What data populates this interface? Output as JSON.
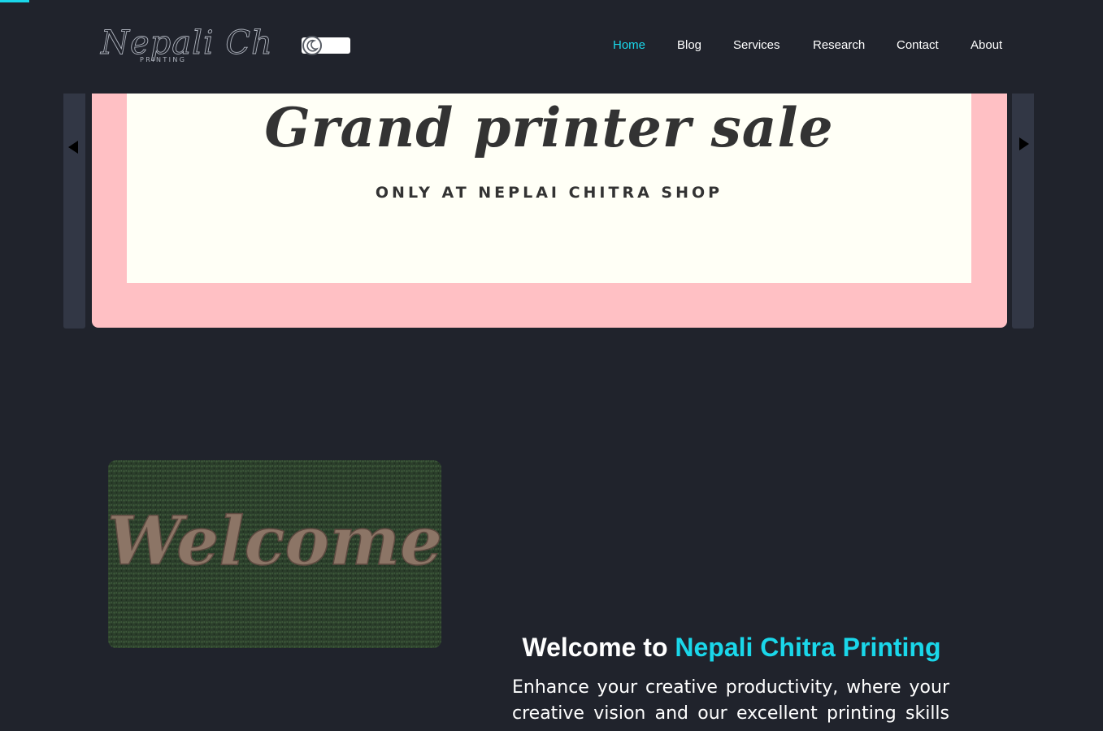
{
  "brand": {
    "logo_name": "Nepali Chitra",
    "logo_tagline": "PRINTING"
  },
  "theme_toggle": {
    "icon": "moon-icon"
  },
  "nav": {
    "items": [
      {
        "label": "Home",
        "active": true
      },
      {
        "label": "Blog"
      },
      {
        "label": "Services"
      },
      {
        "label": "Research"
      },
      {
        "label": "Contact"
      },
      {
        "label": "About"
      }
    ]
  },
  "slider": {
    "prev_icon": "caret-left-icon",
    "next_icon": "caret-right-icon",
    "slide": {
      "headline": "Grand printer sale",
      "subheadline": "ONLY AT NEPLAI CHITRA SHOP"
    }
  },
  "welcome_image": {
    "text": "Welcome"
  },
  "intro": {
    "title_prefix": "Welcome to",
    "title_highlight": "Nepali Chitra Printing",
    "body": "Enhance your creative productivity, where your creative vision and our excellent printing skills"
  },
  "colors": {
    "background": "#20232c",
    "accent": "#1ad7ea",
    "slide_frame": "#ffc0c4",
    "slide_card": "#fffff6",
    "slider_button": "#323745"
  }
}
